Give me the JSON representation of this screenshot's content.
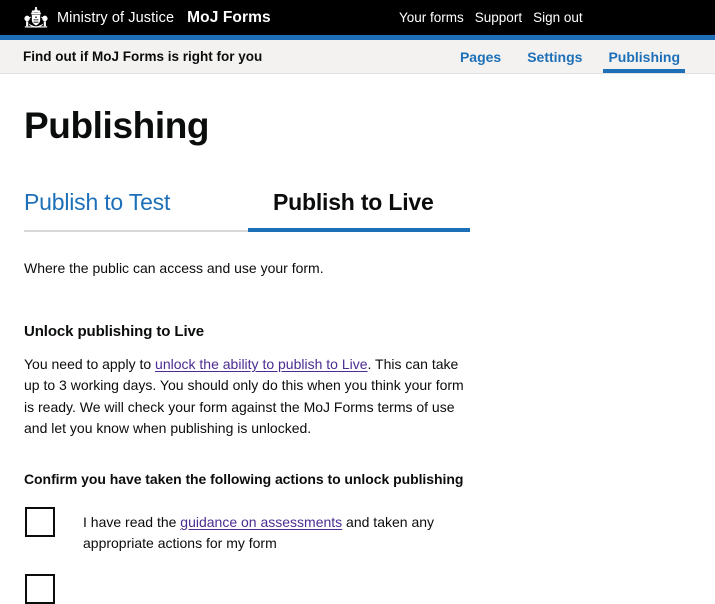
{
  "header": {
    "crest_icon": "royal-coat-of-arms-crest",
    "department": "Ministry of Justice",
    "product": "MoJ Forms",
    "nav": [
      {
        "label": "Your forms"
      },
      {
        "label": "Support"
      },
      {
        "label": "Sign out"
      }
    ],
    "accent_color": "#1d70b8",
    "background_color": "#000000"
  },
  "form_bar": {
    "form_name": "Find out if MoJ Forms is right for you",
    "background_color": "#f3f2f1",
    "tabs": [
      {
        "label": "Pages",
        "active": false
      },
      {
        "label": "Settings",
        "active": false
      },
      {
        "label": "Publishing",
        "active": true
      }
    ]
  },
  "main": {
    "page_title": "Publishing",
    "publish_tabs": [
      {
        "label": "Publish to Test",
        "active": false
      },
      {
        "label": "Publish to Live",
        "active": true
      }
    ],
    "lede": "Where the public can access and use your form.",
    "unlock_section": {
      "heading": "Unlock publishing to Live",
      "paragraph_before_link": "You need to apply to ",
      "link_text": "unlock the ability to publish to Live",
      "paragraph_after_link": ". This can take up to 3 working days. You should only do this when you think your form is ready. We will check your form against the MoJ Forms terms of use and let you know when publishing is unlocked."
    },
    "confirm_heading": "Confirm you have taken the following actions to unlock publishing",
    "checkboxes": [
      {
        "checked": false,
        "text_before_link": "I have read the ",
        "link_text": "guidance on assessments",
        "text_after_link": " and taken any appropriate actions for my form"
      },
      {
        "checked": false,
        "text_before_link": "",
        "link_text": "",
        "text_after_link": ""
      }
    ],
    "link_color": "#4c2c92"
  }
}
